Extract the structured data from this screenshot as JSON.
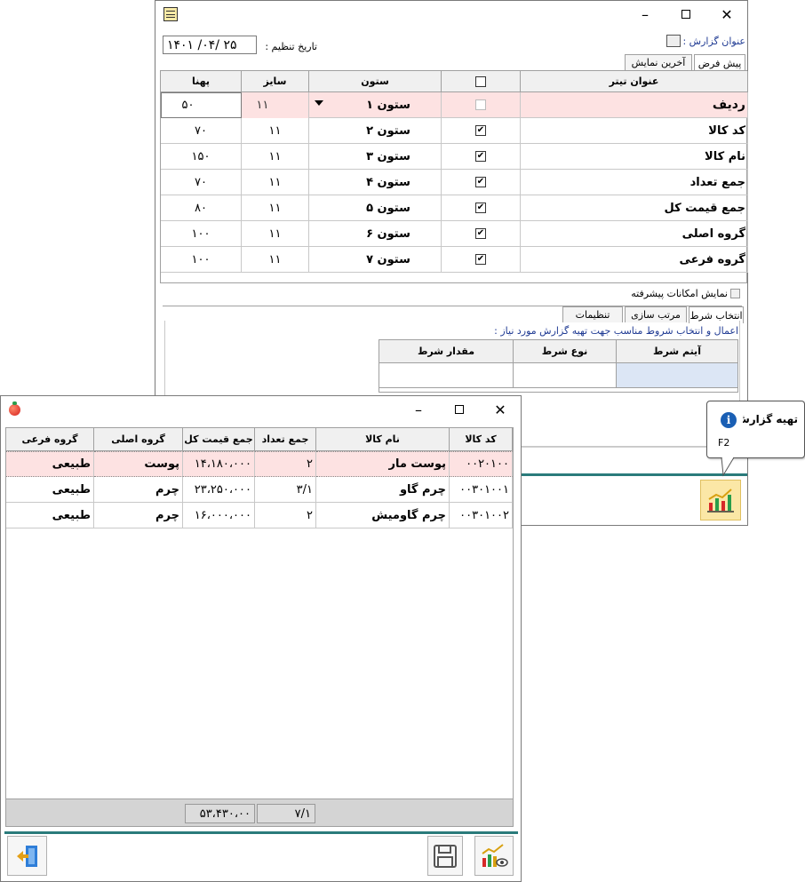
{
  "main_window": {
    "report_title_label": "عنوان گزارش :",
    "date_label": "تاریخ تنظیم :",
    "date_value": "۱۴۰۱ /۰۴/ ۲۵",
    "tabs": [
      "پیش فرض",
      "آخرین نمایش"
    ],
    "grid": {
      "headers": [
        "عنوان تیتر",
        "ستون",
        "سایز",
        "پهنا"
      ],
      "rows": [
        {
          "title": "ردیف",
          "column": "ستون ۱",
          "size": "۱۱",
          "width": "۵۰",
          "checked": false
        },
        {
          "title": "کد کالا",
          "column": "ستون ۲",
          "size": "۱۱",
          "width": "۷۰",
          "checked": true
        },
        {
          "title": "نام کالا",
          "column": "ستون ۳",
          "size": "۱۱",
          "width": "۱۵۰",
          "checked": true
        },
        {
          "title": "جمع تعداد",
          "column": "ستون ۴",
          "size": "۱۱",
          "width": "۷۰",
          "checked": true
        },
        {
          "title": "جمع قیمت کل",
          "column": "ستون ۵",
          "size": "۱۱",
          "width": "۸۰",
          "checked": true
        },
        {
          "title": "گروه اصلی",
          "column": "ستون ۶",
          "size": "۱۱",
          "width": "۱۰۰",
          "checked": true
        },
        {
          "title": "گروه فرعی",
          "column": "ستون ۷",
          "size": "۱۱",
          "width": "۱۰۰",
          "checked": true
        }
      ]
    },
    "advanced_label": "نمایش امکانات پیشرفته",
    "lower_tabs": [
      "انتخاب شرط",
      "مرتب سازی",
      "تنظیمات"
    ],
    "condition_hint": "اعمال و انتخاب شروط مناسب جهت تهیه گزارش  مورد نیاز :",
    "condition_headers": [
      "آیتم شرط",
      "نوع شرط",
      "مقدار شرط"
    ],
    "tooltip_title": "تهیه گزارش",
    "tooltip_key": "F2"
  },
  "result_window": {
    "headers": [
      "کد کالا",
      "نام کالا",
      "جمع تعداد",
      "جمع قیمت کل",
      "گروه اصلی",
      "گروه فرعی"
    ],
    "rows": [
      [
        "۰۰۲۰۱۰۰",
        "پوست مار",
        "۲",
        "۱۴،۱۸۰،۰۰۰",
        "پوست",
        "طبیعی"
      ],
      [
        "۰۰۳۰۱۰۰۱",
        "چرم گاو",
        "۳/۱",
        "۲۳،۲۵۰،۰۰۰",
        "چرم",
        "طبیعی"
      ],
      [
        "۰۰۳۰۱۰۰۲",
        "چرم گاومیش",
        "۲",
        "۱۶،۰۰۰،۰۰۰",
        "چرم",
        "طبیعی"
      ]
    ],
    "footer_qty": "۷/۱",
    "footer_total": "۵۳،۴۳۰،۰۰"
  },
  "colors": {
    "highlight_row": "#fde2e2",
    "teal_bar": "#2a7b7b",
    "selected_cell": "#dce6f5",
    "tooltip_icon": "#1a5fb4"
  }
}
